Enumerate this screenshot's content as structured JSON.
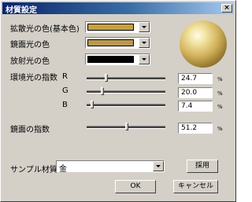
{
  "window": {
    "title": "材質設定",
    "close_label": "×"
  },
  "material": {
    "diffuse": {
      "label": "拡散光の色(基本色)",
      "color": "#c8a040"
    },
    "specular": {
      "label": "鏡面光の色",
      "color": "#b89850"
    },
    "emissive": {
      "label": "放射光の色",
      "color": "#000000"
    }
  },
  "ambient": {
    "label": "環境光の指数",
    "channels": [
      {
        "name": "R",
        "value": "24.7",
        "unit": "%",
        "level": 24.7
      },
      {
        "name": "G",
        "value": "20.0",
        "unit": "%",
        "level": 20.0
      },
      {
        "name": "B",
        "value": "7.4",
        "unit": "%",
        "level": 7.4
      }
    ]
  },
  "specular_exp": {
    "label": "鏡面の指数",
    "value": "51.2",
    "unit": "%",
    "level": 51.2
  },
  "sample": {
    "label": "サンプル材質",
    "selected": "金",
    "apply_label": "採用"
  },
  "buttons": {
    "ok": "OK",
    "cancel": "キャンセル"
  }
}
